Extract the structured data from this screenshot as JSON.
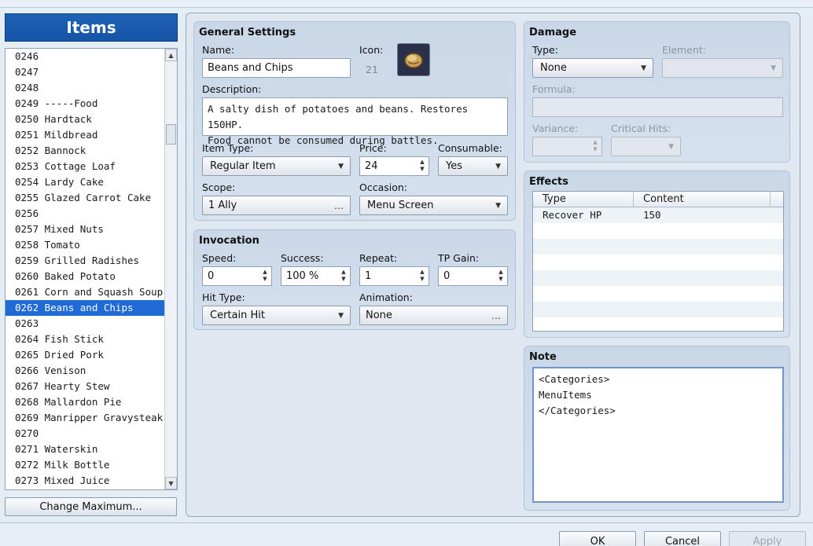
{
  "items_panel": {
    "title": "Items",
    "selected_index": 16,
    "rows": [
      "0246",
      "0247",
      "0248",
      "0249 -----Food",
      "0250 Hardtack",
      "0251 Mildbread",
      "0252 Bannock",
      "0253 Cottage Loaf",
      "0254 Lardy Cake",
      "0255 Glazed Carrot Cake",
      "0256",
      "0257 Mixed Nuts",
      "0258 Tomato",
      "0259 Grilled Radishes",
      "0260 Baked Potato",
      "0261 Corn and Squash Soup",
      "0262 Beans and Chips",
      "0263",
      "0264 Fish Stick",
      "0265 Dried Pork",
      "0266 Venison",
      "0267 Hearty Stew",
      "0268 Mallardon Pie",
      "0269 Manripper Gravysteak",
      "0270",
      "0271 Waterskin",
      "0272 Milk Bottle",
      "0273 Mixed Juice"
    ],
    "change_max_label": "Change Maximum..."
  },
  "general": {
    "title": "General Settings",
    "name_label": "Name:",
    "name_value": "Beans and Chips",
    "icon_label": "Icon:",
    "icon_index": "21",
    "description_label": "Description:",
    "description_lines": [
      "A salty dish of potatoes and beans. Restores 150HP.",
      "Food cannot be consumed during battles."
    ],
    "item_type_label": "Item Type:",
    "item_type_value": "Regular Item",
    "price_label": "Price:",
    "price_value": "24",
    "consumable_label": "Consumable:",
    "consumable_value": "Yes",
    "scope_label": "Scope:",
    "scope_value": "1 Ally",
    "occasion_label": "Occasion:",
    "occasion_value": "Menu Screen"
  },
  "invocation": {
    "title": "Invocation",
    "speed_label": "Speed:",
    "speed_value": "0",
    "success_label": "Success:",
    "success_value": "100 %",
    "repeat_label": "Repeat:",
    "repeat_value": "1",
    "tp_label": "TP Gain:",
    "tp_value": "0",
    "hit_type_label": "Hit Type:",
    "hit_type_value": "Certain Hit",
    "animation_label": "Animation:",
    "animation_value": "None"
  },
  "damage": {
    "title": "Damage",
    "type_label": "Type:",
    "type_value": "None",
    "element_label": "Element:",
    "formula_label": "Formula:",
    "variance_label": "Variance:",
    "critical_label": "Critical Hits:"
  },
  "effects": {
    "title": "Effects",
    "col_type": "Type",
    "col_content": "Content",
    "rows": [
      {
        "type": "Recover HP",
        "content": "150"
      }
    ]
  },
  "note": {
    "title": "Note",
    "lines": [
      "<Categories>",
      "MenuItems",
      "</Categories>"
    ]
  },
  "dialog": {
    "ok_label": "OK",
    "cancel_label": "Cancel",
    "apply_label": "Apply"
  },
  "icons": {
    "item_icon": "bread-icon",
    "ellipsis": "…"
  },
  "colors": {
    "accent": "#1f6ad4",
    "group_bg": "#c9d7e8"
  }
}
